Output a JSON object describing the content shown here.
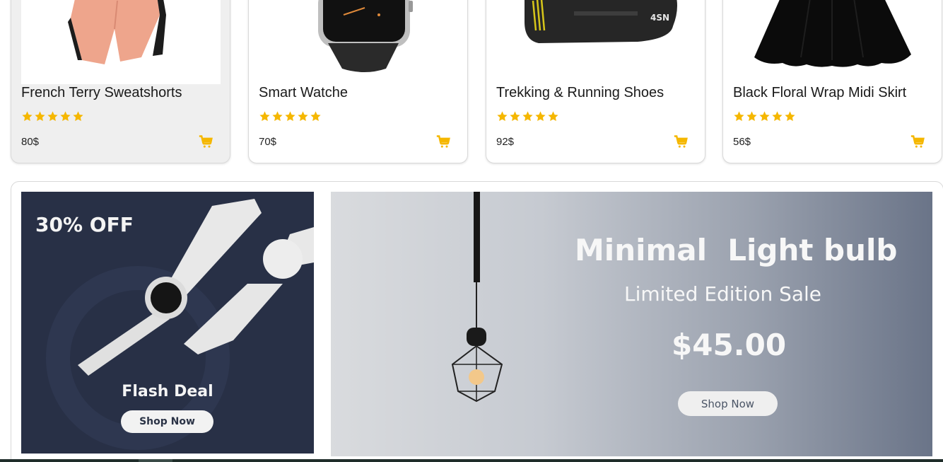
{
  "products": [
    {
      "title": "French Terry Sweatshorts",
      "price": "80$",
      "rating": 5,
      "image": "pink-shorts-image",
      "hovered": true
    },
    {
      "title": "Smart Watche",
      "price": "70$",
      "rating": 5,
      "image": "smart-watch-image",
      "hovered": false
    },
    {
      "title": "Trekking & Running Shoes",
      "price": "92$",
      "rating": 5,
      "image": "black-shoe-image",
      "hovered": false
    },
    {
      "title": "Black Floral Wrap Midi Skirt",
      "price": "56$",
      "rating": 5,
      "image": "black-skirt-image",
      "hovered": false
    }
  ],
  "banners": {
    "flash": {
      "discount": "30% OFF",
      "title": "Flash Deal",
      "button": "Shop Now"
    },
    "light": {
      "title": "Minimal  Light bulb",
      "subtitle": "Limited Edition Sale",
      "price": "$45.00",
      "button": "Shop Now",
      "brand_mark": "4SN"
    }
  },
  "colors": {
    "accent": "#f5b700",
    "star": "#f5b700",
    "flash_bg": "#283046"
  }
}
